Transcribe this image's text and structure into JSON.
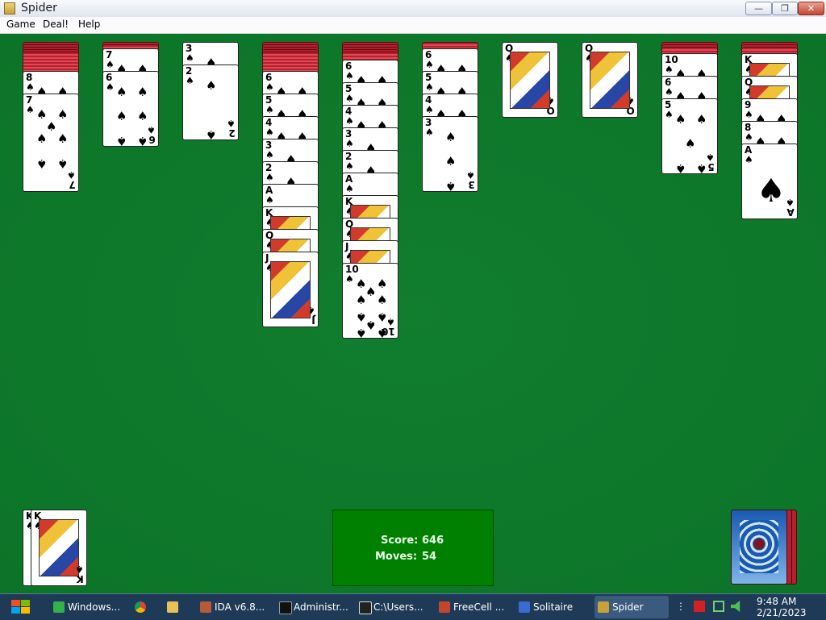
{
  "window": {
    "title": "Spider",
    "min_symbol": "—",
    "max_symbol": "❐",
    "close_symbol": "✕"
  },
  "menu": [
    {
      "label": "Game"
    },
    {
      "label": "Deal!"
    },
    {
      "label": "Help"
    }
  ],
  "tableau": {
    "col1": {
      "visible": [
        "8",
        "7"
      ]
    },
    "col2": {
      "visible": [
        "7",
        "6"
      ]
    },
    "col3": {
      "visible": [
        "3",
        "2"
      ]
    },
    "col4": {
      "visible": [
        "6",
        "5",
        "4",
        "3",
        "2",
        "A",
        "K",
        "Q",
        "J"
      ]
    },
    "col5": {
      "visible": [
        "6",
        "5",
        "4",
        "3",
        "2",
        "A",
        "K",
        "Q",
        "J",
        "10"
      ]
    },
    "col6": {
      "visible": [
        "6",
        "5",
        "4",
        "3"
      ]
    },
    "col7": {
      "visible": [
        "Q"
      ]
    },
    "col8": {
      "visible": [
        "Q"
      ]
    },
    "col9": {
      "visible": [
        "10",
        "6",
        "5"
      ]
    },
    "col10": {
      "visible": [
        "K",
        "Q",
        "9",
        "8",
        "A"
      ]
    }
  },
  "suit_symbol": "♠",
  "foundation": {
    "rank": "K"
  },
  "score": {
    "label": "Score:",
    "value": "646",
    "moves_label": "Moves:",
    "moves_value": "54"
  },
  "taskbar": {
    "items": [
      {
        "label": "Windows..."
      },
      {
        "label": ""
      },
      {
        "label": ""
      },
      {
        "label": "IDA v6.8..."
      },
      {
        "label": "Administr..."
      },
      {
        "label": "C:\\Users..."
      },
      {
        "label": "FreeCell ..."
      },
      {
        "label": "Solitaire"
      },
      {
        "label": "Spider"
      }
    ],
    "time": "9:48 AM",
    "date": "2/21/2023"
  },
  "colors": {
    "felt": "#0a7a2a",
    "score_panel": "#008000",
    "card_back": "#b71f2f"
  }
}
